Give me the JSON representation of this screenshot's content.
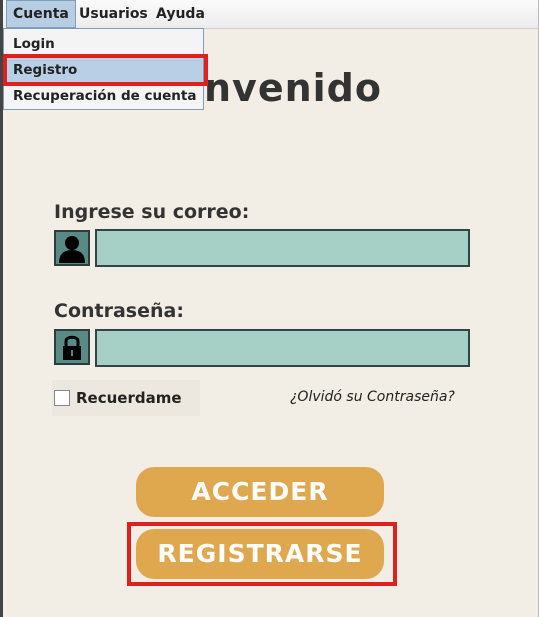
{
  "menubar": {
    "items": [
      {
        "label": "Cuenta"
      },
      {
        "label": "Usuarios"
      },
      {
        "label": "Ayuda"
      }
    ]
  },
  "dropdown": {
    "items": [
      {
        "label": "Login"
      },
      {
        "label": "Registro"
      },
      {
        "label": "Recuperación de cuenta"
      }
    ]
  },
  "main": {
    "title": "nvenido",
    "email_label": "Ingrese su correo:",
    "email_value": "",
    "password_label": "Contraseña:",
    "password_value": "",
    "remember_label": "Recuerdame",
    "forgot_label": "¿Olvidó su Contraseña?",
    "login_button": "ACCEDER",
    "register_button": "REGISTRARSE"
  },
  "colors": {
    "field_bg": "#a6cfc6",
    "icon_bg": "#5a8a86",
    "button_bg": "#dfa84f",
    "highlight": "#e0201c",
    "menu_selected": "#b8cfe5"
  }
}
